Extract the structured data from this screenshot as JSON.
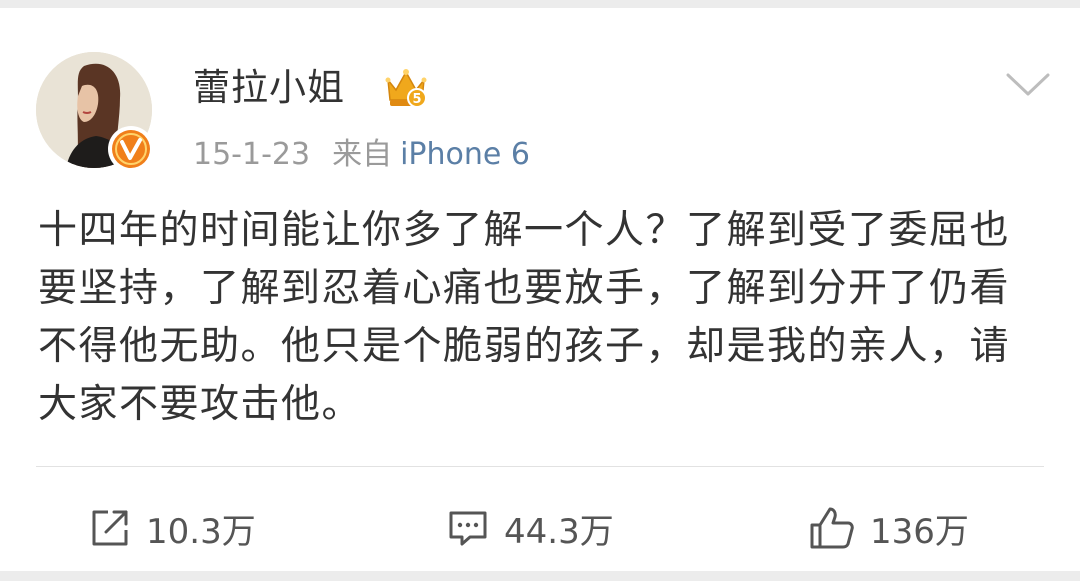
{
  "post": {
    "author": {
      "name": "蕾拉小姐",
      "avatar": "avatar",
      "verified_badge": "verified-v-icon",
      "member_badge": "crown-level-icon",
      "member_level": "5"
    },
    "meta": {
      "date": "15-1-23",
      "source_prefix": "来自",
      "source_device": "iPhone 6"
    },
    "text": "十四年的时间能让你多了解一个人？了解到受了委屈也要坚持，了解到忍着心痛也要放手，了解到分开了仍看不得他无助。他只是个脆弱的孩子，却是我的亲人，请大家不要攻击他。",
    "menu_icon": "chevron-down-icon"
  },
  "actions": {
    "repost": {
      "icon": "repost-icon",
      "count": "10.3万"
    },
    "comment": {
      "icon": "comment-icon",
      "count": "44.3万"
    },
    "like": {
      "icon": "thumbs-up-icon",
      "count": "136万"
    }
  },
  "colors": {
    "text": "#333333",
    "meta": "#9a9a9a",
    "link": "#5b7fa6",
    "badge_orange": "#f07f1a",
    "crown_gold": "#f0a81c"
  }
}
